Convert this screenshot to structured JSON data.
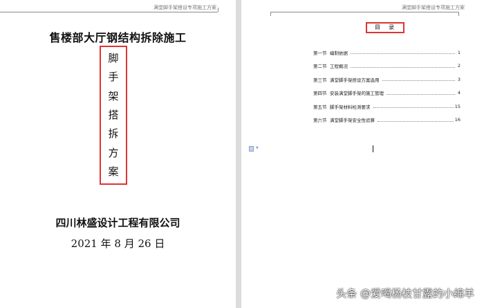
{
  "left_page": {
    "header": "满堂脚手架搭设专项施工方案",
    "title": "售楼部大厅钢结构拆除施工",
    "vertical_title": [
      "脚",
      "手",
      "架",
      "搭",
      "拆",
      "方",
      "案"
    ],
    "company": "四川林盛设计工程有限公司",
    "date": "2021 年 8 月 26 日"
  },
  "right_page": {
    "header": "满堂脚手架搭设专项施工方案",
    "toc_title": "目　录",
    "toc": [
      {
        "num": "第一节",
        "text": "编制依据",
        "page": "1"
      },
      {
        "num": "第二节",
        "text": "工程概况",
        "page": "2"
      },
      {
        "num": "第三节",
        "text": "满堂脚手架搭设方案选用",
        "page": "3"
      },
      {
        "num": "第四节",
        "text": "安装满堂脚手架的施工管理",
        "page": "4"
      },
      {
        "num": "第五节",
        "text": "脚手架材料检测要求",
        "page": "15"
      },
      {
        "num": "第六节",
        "text": "满堂脚手架安全性验算",
        "page": "16"
      }
    ]
  },
  "watermark": "头条 @爱喝杨枝甘露的小绵羊",
  "colors": {
    "highlight_box": "#dd3333",
    "background": "#e3e3e3"
  }
}
